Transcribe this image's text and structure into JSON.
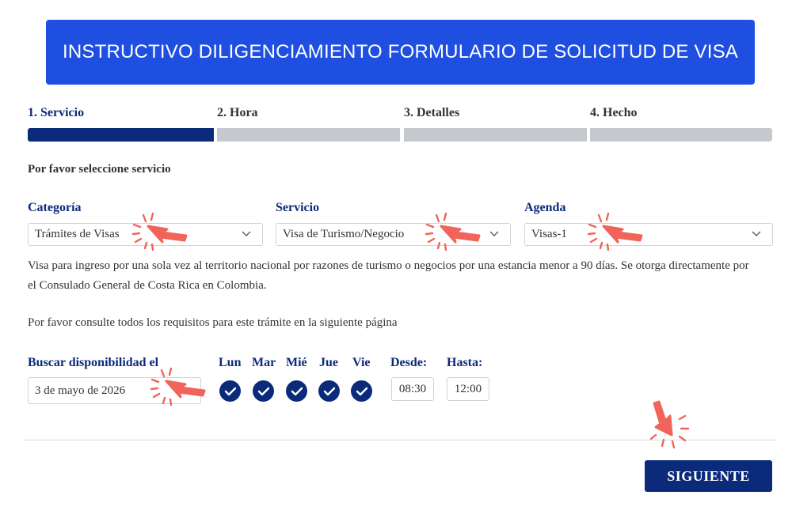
{
  "banner": {
    "title": "INSTRUCTIVO DILIGENCIAMIENTO FORMULARIO DE SOLICITUD DE VISA"
  },
  "steps": [
    {
      "label": "1. Servicio",
      "active": true
    },
    {
      "label": "2. Hora",
      "active": false
    },
    {
      "label": "3. Detalles",
      "active": false
    },
    {
      "label": "4. Hecho",
      "active": false
    }
  ],
  "prompt": "Por favor seleccione servicio",
  "fields": {
    "categoria": {
      "label": "Categoría",
      "value": "Trámites de Visas"
    },
    "servicio": {
      "label": "Servicio",
      "value": "Visa de Turismo/Negocio"
    },
    "agenda": {
      "label": "Agenda",
      "value": "Visas-1"
    }
  },
  "description": "Visa para ingreso por una sola vez al territorio nacional por razones de turismo o negocios por una estancia menor a 90 días. Se otorga directamente por el Consulado General de Costa Rica en Colombia.",
  "consult_text": "Por favor consulte todos los requisitos para este trámite en la siguiente página",
  "availability": {
    "label": "Buscar disponibilidad el",
    "date": "3 de mayo de 2026",
    "days": [
      "Lun",
      "Mar",
      "Mié",
      "Jue",
      "Vie"
    ],
    "desde_label": "Desde:",
    "desde_value": "08:30",
    "hasta_label": "Hasta:",
    "hasta_value": "12:00"
  },
  "next_button": "SIGUIENTE",
  "colors": {
    "banner": "#1e4fe0",
    "primary": "#0b2a7a",
    "inactive_bar": "#c5c8cc",
    "pointer": "#f0645a"
  }
}
